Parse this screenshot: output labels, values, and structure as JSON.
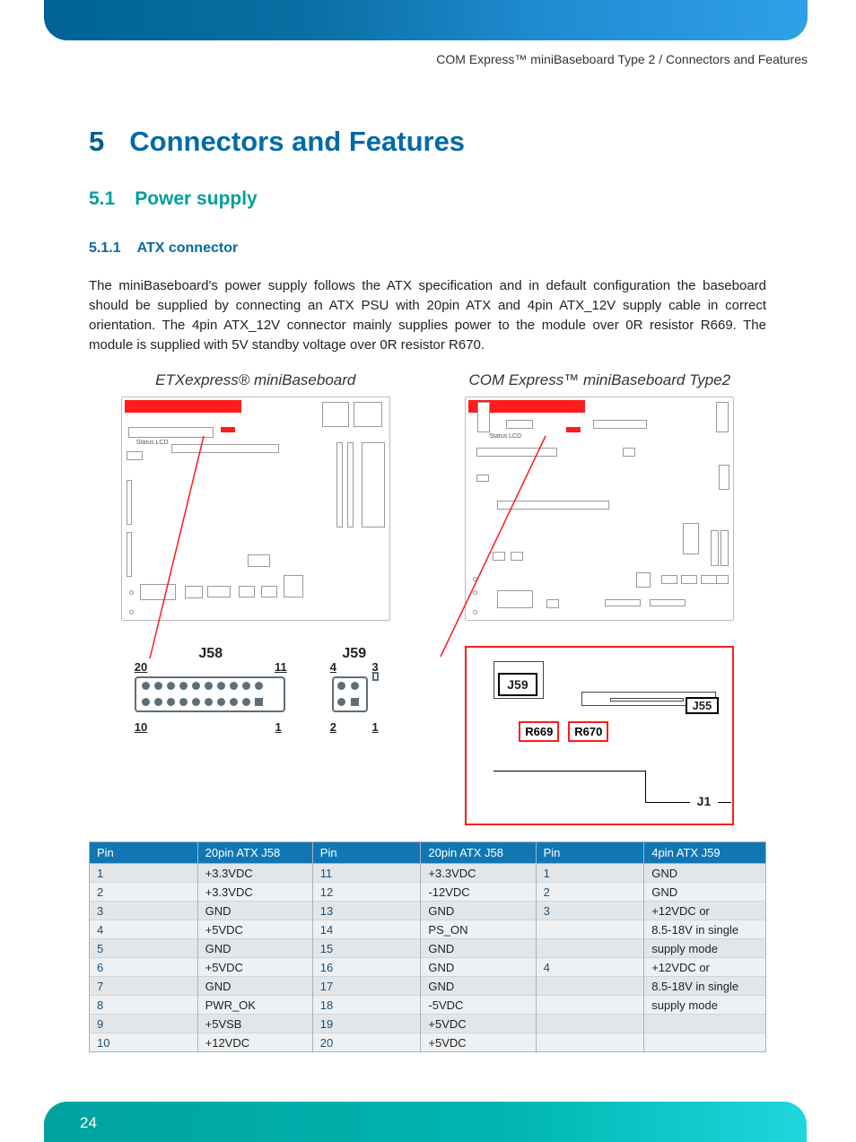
{
  "breadcrumb": "COM Express™ miniBaseboard Type 2 / Connectors and Features",
  "h1": {
    "num": "5",
    "text": "Connectors and Features"
  },
  "h2": {
    "num": "5.1",
    "text": "Power supply"
  },
  "h3": {
    "num": "5.1.1",
    "text": "ATX connector"
  },
  "paragraph": "The miniBaseboard's power supply follows the ATX specification and in default configuration the baseboard should be supplied by connecting an ATX PSU with 20pin ATX and 4pin ATX_12V supply cable in correct orientation. The 4pin ATX_12V connector mainly supplies power to the module over 0R resistor R669. The module is supplied with 5V standby voltage over 0R resistor R670.",
  "fig_left_title": "ETXexpress® miniBaseboard",
  "fig_right_title": "COM Express™ miniBaseboard Type2",
  "conn_j58": "J58",
  "conn_j59": "J59",
  "pins_j58_20": "20",
  "pins_j58_11": "11",
  "pins_j58_10": "10",
  "pins_j58_1": "1",
  "pins_j59_4": "4",
  "pins_j59_3": "3",
  "pins_j59_2": "2",
  "pins_j59_1": "1",
  "detail_j59": "J59",
  "detail_j55": "J55",
  "detail_j1": "J1",
  "detail_r669": "R669",
  "detail_r670": "R670",
  "table": {
    "headers": [
      "Pin",
      "20pin ATX J58",
      "Pin",
      "20pin ATX J58",
      "Pin",
      "4pin ATX J59"
    ],
    "rows": [
      [
        "1",
        "+3.3VDC",
        "11",
        "+3.3VDC",
        "1",
        "GND"
      ],
      [
        "2",
        "+3.3VDC",
        "12",
        "-12VDC",
        "2",
        "GND"
      ],
      [
        "3",
        "GND",
        "13",
        "GND",
        "3",
        "+12VDC or"
      ],
      [
        "4",
        "+5VDC",
        "14",
        "PS_ON",
        "",
        "8.5-18V in single"
      ],
      [
        "5",
        "GND",
        "15",
        "GND",
        "",
        "supply mode"
      ],
      [
        "6",
        "+5VDC",
        "16",
        "GND",
        "4",
        "+12VDC or"
      ],
      [
        "7",
        "GND",
        "17",
        "GND",
        "",
        "8.5-18V in single"
      ],
      [
        "8",
        "PWR_OK",
        "18",
        "-5VDC",
        "",
        "supply mode"
      ],
      [
        "9",
        "+5VSB",
        "19",
        "+5VDC",
        "",
        ""
      ],
      [
        "10",
        "+12VDC",
        "20",
        "+5VDC",
        "",
        ""
      ]
    ]
  },
  "page_number": "24"
}
